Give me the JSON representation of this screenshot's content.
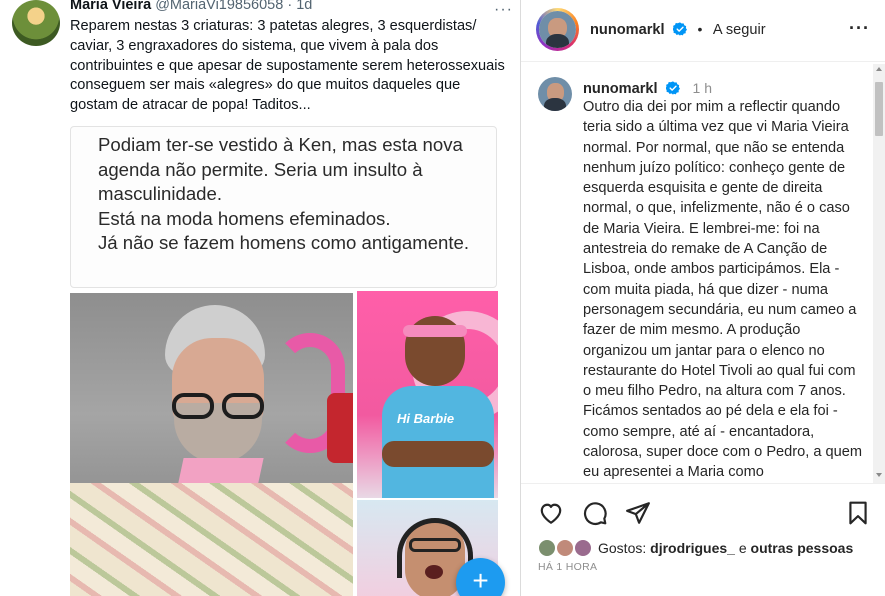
{
  "tweet": {
    "author_name": "Maria Vieira",
    "author_handle": "@MariaVi19856058",
    "separator": "·",
    "age": "1d",
    "more": "···",
    "text": "Reparem nestas 3 criaturas: 3 patetas alegres, 3 esquerdistas/ caviar, 3 engraxadores do sistema, que vivem à pala dos contribuintes e que apesar de supostamente serem heterossexuais conseguem ser mais «alegres» do que muitos daqueles que gostam de atracar de popa! Taditos...",
    "quoted_text": "Podiam ter-se vestido à Ken, mas esta nova agenda não permite. Seria um insulto à masculinidade.\nEstá na moda homens efeminados.\nJá não se fazem homens como antigamente.",
    "photo_shirt_label": "Hi Barbie",
    "fab_label": "+"
  },
  "post": {
    "header": {
      "username": "nunomarkl",
      "dot": "•",
      "follow_label": "A seguir",
      "more": "···"
    },
    "caption": {
      "username": "nunomarkl",
      "time": "1 h",
      "text": "Outro dia dei por mim a reflectir quando teria sido a última vez que vi Maria Vieira normal. Por normal, que não se entenda nenhum juízo político: conheço gente de esquerda esquisita e gente de direita normal, o que, infelizmente, não é o caso de Maria Vieira. E lembrei-me: foi na antestreia do remake de A Canção de Lisboa, onde ambos participámos. Ela - com muita piada, há que dizer - numa personagem secundária, eu num cameo a fazer de mim mesmo. A produção organizou um jantar para o elenco no restaurante do Hotel Tivoli ao qual fui com o meu filho Pedro, na altura com 7 anos. Ficámos sentados ao pé dela e ela foi - como sempre, até aí - encantadora, calorosa, super doce com o Pedro, a quem eu apresentei a Maria como"
    },
    "likes": {
      "prefix": "Gostos: ",
      "first_user": "djrodrigues_",
      "connector": " e ",
      "others": "outras pessoas"
    },
    "time_ago": "HÁ 1 HORA"
  },
  "colors": {
    "verified_blue": "#0095f6",
    "twitter_blue": "#1d9bf0",
    "text_primary": "#262626",
    "text_secondary": "#8e8e8e"
  },
  "icons": [
    "verified-badge-icon",
    "heart-icon",
    "comment-icon",
    "share-icon",
    "bookmark-icon",
    "more-icon",
    "plus-icon"
  ]
}
